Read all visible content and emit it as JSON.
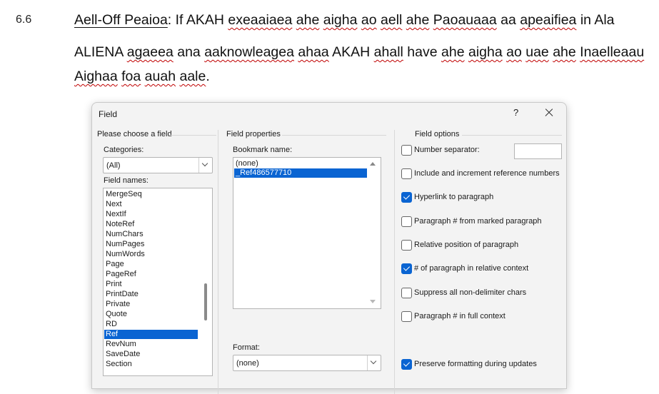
{
  "document": {
    "section_number": "6.6",
    "line1": {
      "heading": "Aell-Off Peaioa",
      "colon": ":",
      "w1": "If",
      "w2": "AKAH",
      "w3": "exeaaiaea",
      "w4": "ahe",
      "w5": "aigha",
      "w6": "ao",
      "w7": "aell",
      "w8": "ahe",
      "w9": "Paoauaaa",
      "w10": "aa",
      "w11": "apeaifiea",
      "w12": "in",
      "w13": "Ala"
    },
    "line2": {
      "w1": "ALIENA",
      "w2": "agaeea",
      "w3": "ana",
      "w4": "aaknowleagea",
      "w5": "ahaa",
      "w6": "AKAH",
      "w7": "ahall",
      "w8": "have",
      "w9": "ahe",
      "w10": "aigha",
      "w11": "ao",
      "w12": "uae",
      "w13": "ahe",
      "w14": "Inaelleaau"
    },
    "line3": {
      "w1": "Aighaa",
      "w2": "foa",
      "w3": "auah",
      "w4": "aale",
      "end": "."
    }
  },
  "dialog": {
    "title": "Field",
    "help_label": "?",
    "left_panel": {
      "heading": "Please choose a field",
      "categories_label": "Categories:",
      "categories_value": "(All)",
      "field_names_label": "Field names:",
      "field_names": [
        "MergeSeq",
        "Next",
        "NextIf",
        "NoteRef",
        "NumChars",
        "NumPages",
        "NumWords",
        "Page",
        "PageRef",
        "Print",
        "PrintDate",
        "Private",
        "Quote",
        "RD",
        "Ref",
        "RevNum",
        "SaveDate",
        "Section"
      ],
      "selected_field": "Ref"
    },
    "middle_panel": {
      "heading": "Field properties",
      "bookmark_label": "Bookmark name:",
      "bookmarks": [
        "(none)",
        "_Ref486577710"
      ],
      "selected_bookmark": "_Ref486577710",
      "format_label": "Format:",
      "format_value": "(none)"
    },
    "right_panel": {
      "heading": "Field options",
      "options": [
        {
          "label": "Number separator:",
          "checked": false
        },
        {
          "label": "Include and increment reference numbers",
          "checked": false
        },
        {
          "label": "Hyperlink to paragraph",
          "checked": true
        },
        {
          "label": "Paragraph # from marked paragraph",
          "checked": false
        },
        {
          "label": "Relative position of paragraph",
          "checked": false
        },
        {
          "label": "# of paragraph in relative context",
          "checked": true
        },
        {
          "label": "Suppress all non-delimiter chars",
          "checked": false
        },
        {
          "label": "Paragraph # in full context",
          "checked": false
        },
        {
          "label": "Preserve formatting during updates",
          "checked": true
        }
      ]
    },
    "accent_color": "#0a64d2"
  }
}
